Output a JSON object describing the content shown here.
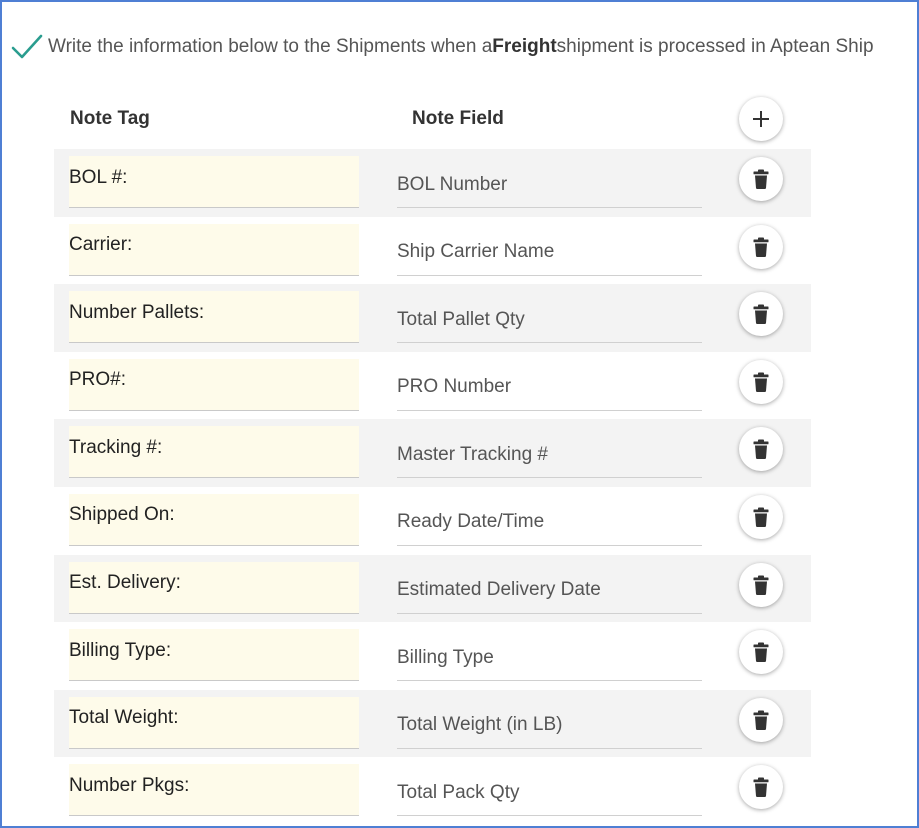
{
  "header": {
    "text_before": "Write the information below to the Shipments when a ",
    "bold_word": "Freight",
    "text_after": " shipment is processed in Aptean Ship"
  },
  "columns": {
    "tag": "Note Tag",
    "field": "Note Field"
  },
  "icons": {
    "check": "check-icon",
    "add": "plus-icon",
    "delete": "trash-icon"
  },
  "colors": {
    "accent_check": "#2a9d8f",
    "border": "#4f7fd4",
    "tag_bg": "#fefbea",
    "row_shade": "#f3f3f3"
  },
  "rows": [
    {
      "tag": "BOL #:",
      "field": "BOL Number"
    },
    {
      "tag": "Carrier:",
      "field": "Ship Carrier Name"
    },
    {
      "tag": "Number Pallets:",
      "field": "Total Pallet Qty"
    },
    {
      "tag": "PRO#:",
      "field": "PRO Number"
    },
    {
      "tag": "Tracking #:",
      "field": "Master Tracking #"
    },
    {
      "tag": "Shipped On:",
      "field": "Ready Date/Time"
    },
    {
      "tag": "Est. Delivery:",
      "field": "Estimated Delivery Date"
    },
    {
      "tag": "Billing Type:",
      "field": "Billing Type"
    },
    {
      "tag": "Total Weight:",
      "field": "Total Weight (in LB)"
    },
    {
      "tag": "Number Pkgs:",
      "field": "Total Pack Qty"
    }
  ]
}
